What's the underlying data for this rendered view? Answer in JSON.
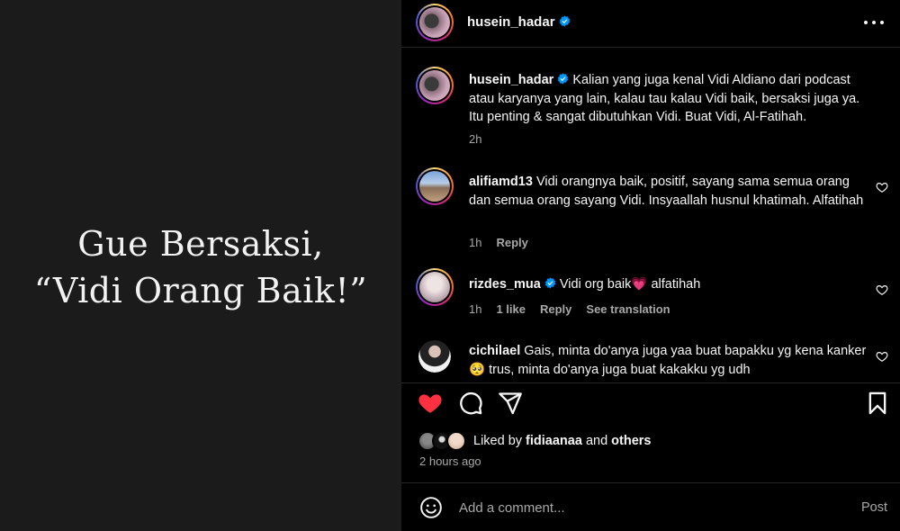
{
  "image": {
    "line1": "Gue Bersaksi,",
    "line2": "“Vidi Orang Baik!”"
  },
  "header": {
    "username": "husein_hadar",
    "verified": true,
    "more_icon": "more-horizontal-icon"
  },
  "caption": {
    "username": "husein_hadar",
    "text": "Kalian yang juga kenal Vidi Aldiano dari podcast atau karyanya yang lain, kalau tau kalau Vidi baik, bersaksi juga ya. Itu penting & sangat dibutuhkan Vidi. Buat Vidi, Al-Fatihah.",
    "time": "2h"
  },
  "comments": [
    {
      "username": "alifiamd13",
      "verified": false,
      "text": "Vidi orangnya baik, positif, sayang sama semua orang dan semua orang sayang Vidi. Insyaallah husnul khatimah. Alfatihah",
      "time": "1h",
      "reply_label": "Reply"
    },
    {
      "username": "rizdes_mua",
      "verified": true,
      "text_before": "Vidi org baik",
      "emoji": "💗",
      "text_after": "alfatihah",
      "time": "1h",
      "likes_label": "1 like",
      "reply_label": "Reply",
      "translation_label": "See translation"
    },
    {
      "username": "cichilael",
      "verified": false,
      "text_before": "Gais, minta do'anya juga yaa buat bapakku yg kena kanker",
      "emoji": "🥺",
      "text_after": "trus, minta do'anya juga buat kakakku yg udh"
    }
  ],
  "actions": {
    "like_icon": "heart-filled-icon",
    "comment_icon": "comment-icon",
    "share_icon": "share-icon",
    "save_icon": "bookmark-icon",
    "like_color": "#ff3040"
  },
  "likes": {
    "prefix": "Liked by",
    "user": "fidiaanaa",
    "connector": "and",
    "suffix": "others",
    "time_ago": "2 hours ago"
  },
  "add_comment": {
    "placeholder": "Add a comment...",
    "post_label": "Post",
    "emoji_icon": "emoji-icon"
  }
}
